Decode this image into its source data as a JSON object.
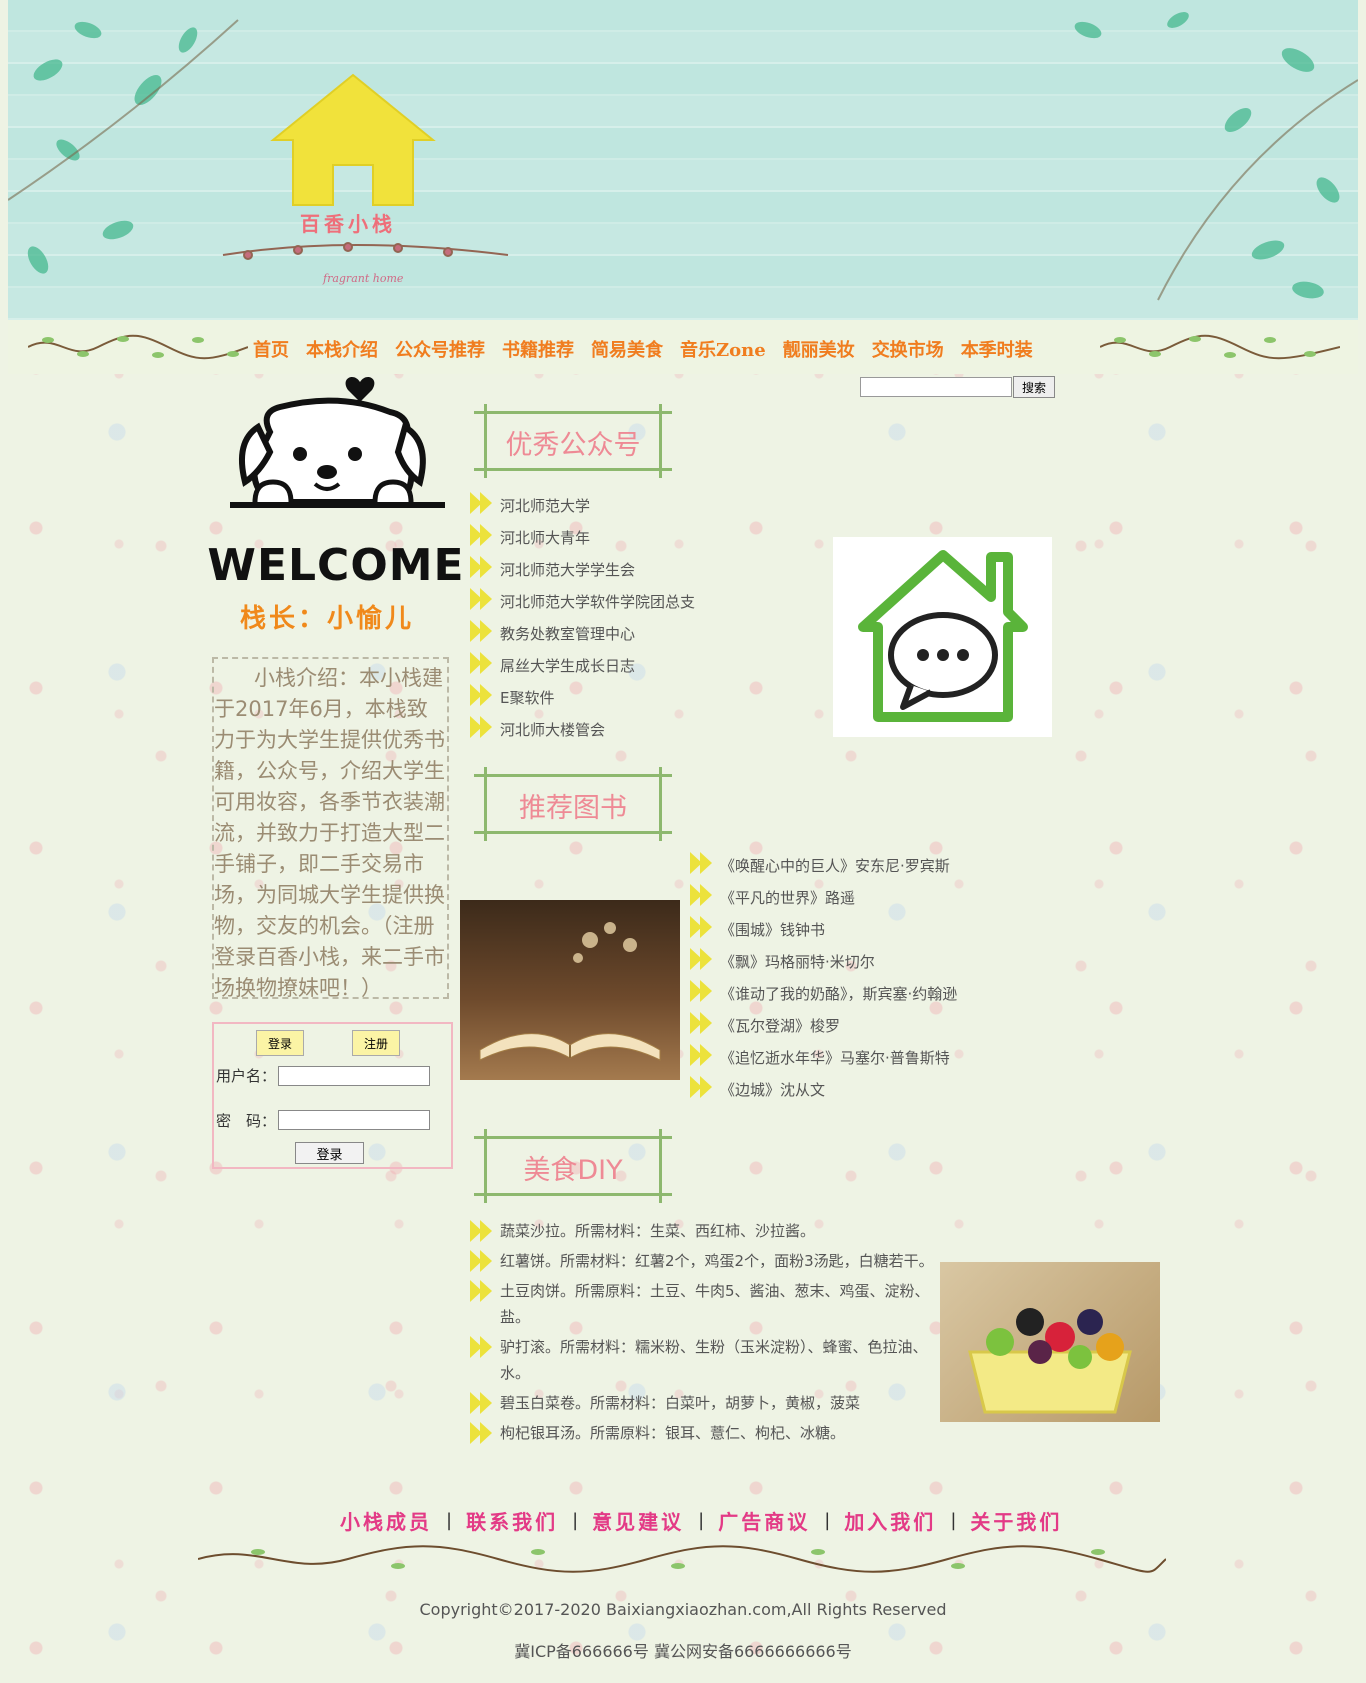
{
  "site": {
    "logo_text": "百香小栈",
    "logo_subtext": "fragrant home"
  },
  "nav": {
    "items": [
      "首页",
      "本栈介绍",
      "公众号推荐",
      "书籍推荐",
      "简易美食",
      "音乐Zone",
      "靓丽美妆",
      "交换市场",
      "本季时装"
    ]
  },
  "search": {
    "button_label": "搜索",
    "value": ""
  },
  "left": {
    "welcome": "WELCOME",
    "owner": "栈长：小愉儿",
    "intro": "小栈介绍：本小栈建于2017年6月，本栈致力于为大学生提供优秀书籍，公众号，介绍大学生可用妆容，各季节衣装潮流，并致力于打造大型二手铺子，即二手交易市场，为同城大学生提供换物，交友的机会。（注册登录百香小栈，来二手市场换物撩妹吧！）"
  },
  "login": {
    "tab_login": "登录",
    "tab_register": "注册",
    "username_label": "用户名：",
    "password_label": "密　码：",
    "username_value": "",
    "password_value": "",
    "submit_label": "登录"
  },
  "sections": {
    "wechat": {
      "title": "优秀公众号",
      "items": [
        "河北师范大学",
        "河北师大青年",
        "河北师范大学学生会",
        "河北师范大学软件学院团总支",
        "教务处教室管理中心",
        "屌丝大学生成长日志",
        "E聚软件",
        "河北师大楼管会"
      ]
    },
    "books": {
      "title": "推荐图书",
      "items": [
        "《唤醒心中的巨人》安东尼·罗宾斯",
        "《平凡的世界》路遥",
        "《围城》钱钟书",
        "《飘》玛格丽特·米切尔",
        "《谁动了我的奶酪》，斯宾塞·约翰逊",
        "《瓦尔登湖》梭罗",
        "《追忆逝水年华》马塞尔·普鲁斯特",
        "《边城》沈从文"
      ]
    },
    "food": {
      "title": "美食DIY",
      "items": [
        "蔬菜沙拉。所需材料：生菜、西红柿、沙拉酱。",
        "红薯饼。所需材料：红薯2个，鸡蛋2个，面粉3汤匙，白糖若干。",
        "土豆肉饼。所需原料：土豆、牛肉5、酱油、葱末、鸡蛋、淀粉、盐。",
        "驴打滚。所需材料：糯米粉、生粉（玉米淀粉）、蜂蜜、色拉油、水。",
        "碧玉白菜卷。所需材料：白菜叶，胡萝卜，黄椒，菠菜",
        "枸杞银耳汤。所需原料：银耳、薏仁、枸杞、冰糖。"
      ]
    }
  },
  "footer": {
    "links": [
      "小栈成员",
      "联系我们",
      "意见建议",
      "广告商议",
      "加入我们",
      "关于我们"
    ],
    "separator": "|",
    "copyright": "Copyright©2017-2020 Baixiangxiaozhan.com,All Rights Reserved",
    "icp": "冀ICP备666666号 冀公网安备6666666666号"
  },
  "colors": {
    "nav_text": "#f07d1f",
    "owner_text": "#f0891b",
    "section_title": "#ee8a95",
    "footer_link": "#e33a86",
    "arrow": "#ece23b"
  },
  "icons": [
    "house-logo-icon",
    "puppy-icon",
    "chat-house-icon",
    "arrow-bullet-icon",
    "vine-decoration"
  ]
}
